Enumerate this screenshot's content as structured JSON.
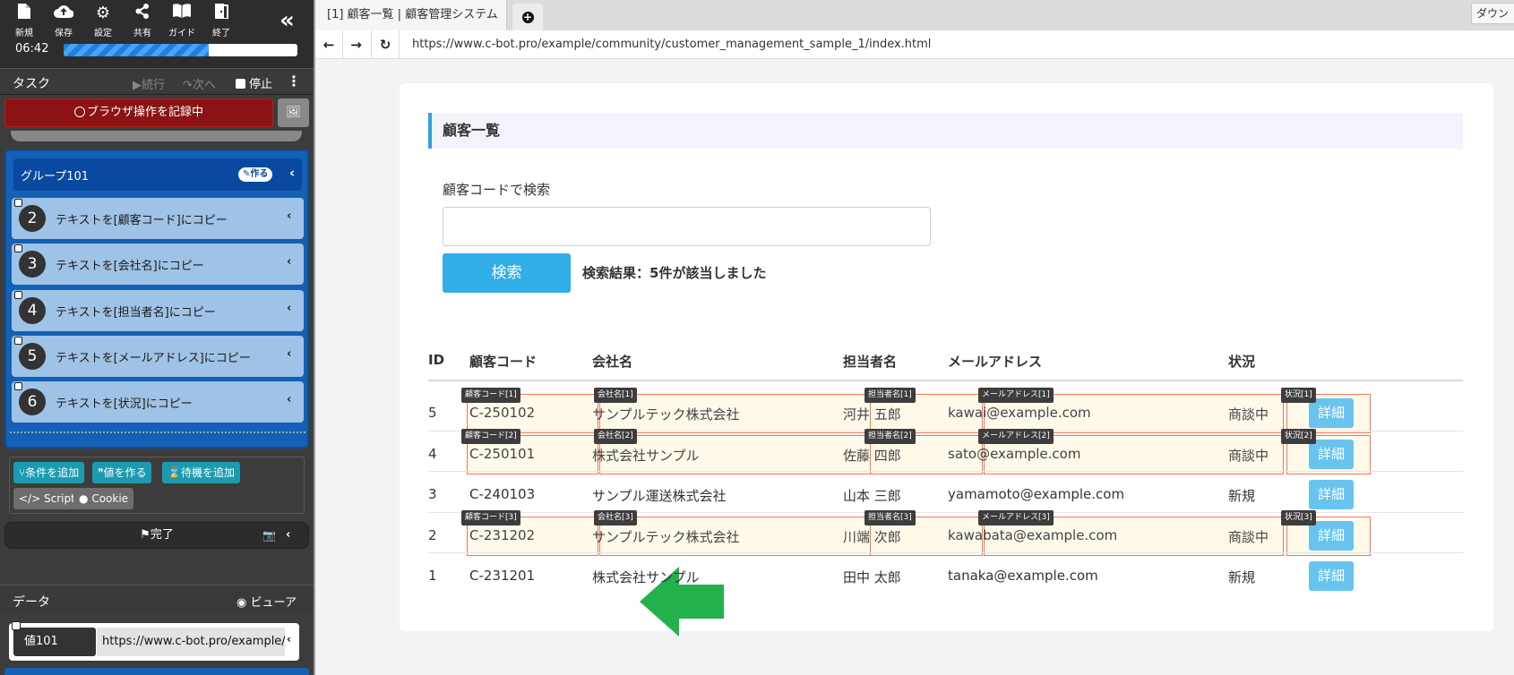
{
  "toolbar": {
    "buttons": [
      {
        "label": "新規",
        "icon": "new-file-icon"
      },
      {
        "label": "保存",
        "icon": "cloud-upload-icon"
      },
      {
        "label": "設定",
        "icon": "gear-icon"
      },
      {
        "label": "共有",
        "icon": "share-icon"
      },
      {
        "label": "ガイド",
        "icon": "book-icon"
      },
      {
        "label": "終了",
        "icon": "exit-door-icon"
      }
    ],
    "timer": "06:42",
    "progress_fraction": 0.62
  },
  "task": {
    "title": "タスク",
    "continue_label": "続行",
    "next_label": "次へ",
    "stop_label": "停止",
    "recording_label": "ブラウザ操作を記録中"
  },
  "group": {
    "title": "グループ101",
    "badge": "作る",
    "steps": [
      {
        "number": "2",
        "label": "テキストを[顧客コード]にコピー"
      },
      {
        "number": "3",
        "label": "テキストを[会社名]にコピー"
      },
      {
        "number": "4",
        "label": "テキストを[担当者名]にコピー"
      },
      {
        "number": "5",
        "label": "テキストを[メールアドレス]にコピー"
      },
      {
        "number": "6",
        "label": "テキストを[状況]にコピー"
      }
    ]
  },
  "actions": {
    "add_condition": "条件を追加",
    "make_value": "値を作る",
    "add_wait": "待機を追加",
    "script": "Script",
    "cookie": "Cookie",
    "done": "完了"
  },
  "data_panel": {
    "title": "データ",
    "viewer": "ビューア",
    "value_key": "値101",
    "value_text": "https://www.c-bot.pro/example/c"
  },
  "browser": {
    "tab_title": "[1] 顧客一覧 | 顧客管理システム",
    "download_label": "ダウン",
    "url": "https://www.c-bot.pro/example/community/customer_management_sample_1/index.html"
  },
  "page": {
    "title": "顧客一覧",
    "search_label": "顧客コードで検索",
    "search_placeholder": "",
    "search_button": "検索",
    "result_text": "検索結果：5件が該当しました",
    "columns": [
      "ID",
      "顧客コード",
      "会社名",
      "担当者名",
      "メールアドレス",
      "状況"
    ],
    "detail_label": "詳細",
    "rows": [
      {
        "id": "5",
        "code": "C-250102",
        "company": "サンプルテック株式会社",
        "person": "河井 五郎",
        "email": "kawai@example.com",
        "status": "商談中",
        "tags": [
          "顧客コード[1]",
          "会社名[1]",
          "担当者名[1]",
          "メールアドレス[1]",
          "状況[1]"
        ]
      },
      {
        "id": "4",
        "code": "C-250101",
        "company": "株式会社サンプル",
        "person": "佐藤 四郎",
        "email": "sato@example.com",
        "status": "商談中",
        "tags": [
          "顧客コード[2]",
          "会社名[2]",
          "担当者名[2]",
          "メールアドレス[2]",
          "状況[2]"
        ]
      },
      {
        "id": "3",
        "code": "C-240103",
        "company": "サンプル運送株式会社",
        "person": "山本 三郎",
        "email": "yamamoto@example.com",
        "status": "新規",
        "tags": []
      },
      {
        "id": "2",
        "code": "C-231202",
        "company": "サンプルテック株式会社",
        "person": "川端 次郎",
        "email": "kawabata@example.com",
        "status": "商談中",
        "tags": [
          "顧客コード[3]",
          "会社名[3]",
          "担当者名[3]",
          "メールアドレス[3]",
          "状況[3]"
        ]
      },
      {
        "id": "1",
        "code": "C-231201",
        "company": "株式会社サンプル",
        "person": "田中 太郎",
        "email": "tanaka@example.com",
        "status": "新規",
        "tags": []
      }
    ]
  },
  "colors": {
    "recording": "#8b1313",
    "group_bg": "#1360b4",
    "step_bg": "#9ec3e6",
    "accent": "#31aee6",
    "highlight_border": "#f0775a",
    "arrow": "#22b14c"
  }
}
